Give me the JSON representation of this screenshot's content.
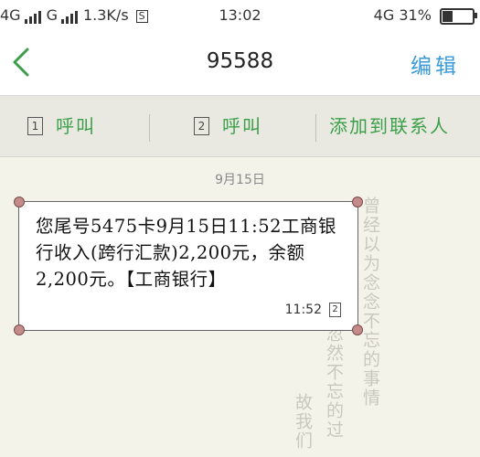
{
  "status_bar": {
    "network1": "4G",
    "network2": "G",
    "speed": "1.3K/s",
    "speed_icon_letter": "S",
    "time": "13:02",
    "right_network": "4G",
    "battery_text": "31%",
    "battery_level": 0.31
  },
  "header": {
    "title": "95588",
    "edit_label": "编辑",
    "back_icon": "chevron-left-icon"
  },
  "actions": {
    "call1_sim": "1",
    "call1_label": "呼叫",
    "call2_sim": "2",
    "call2_label": "呼叫",
    "add_contact_label": "添加到联系人"
  },
  "conversation": {
    "date": "9月15日",
    "message": {
      "text": "您尾号5475卡9月15日11:52工商银行收入(跨行汇款)2,200元，余额2,200元。【工商银行】",
      "time": "11:52",
      "sim": "2"
    }
  },
  "decor": {
    "col1": "曾经以为念念不忘的事情",
    "col2": "忽然不忘的过",
    "col3": "故我们"
  },
  "colors": {
    "accent_green": "#3b9f49",
    "accent_blue": "#3a9ad9",
    "background": "#f4f3ea"
  }
}
